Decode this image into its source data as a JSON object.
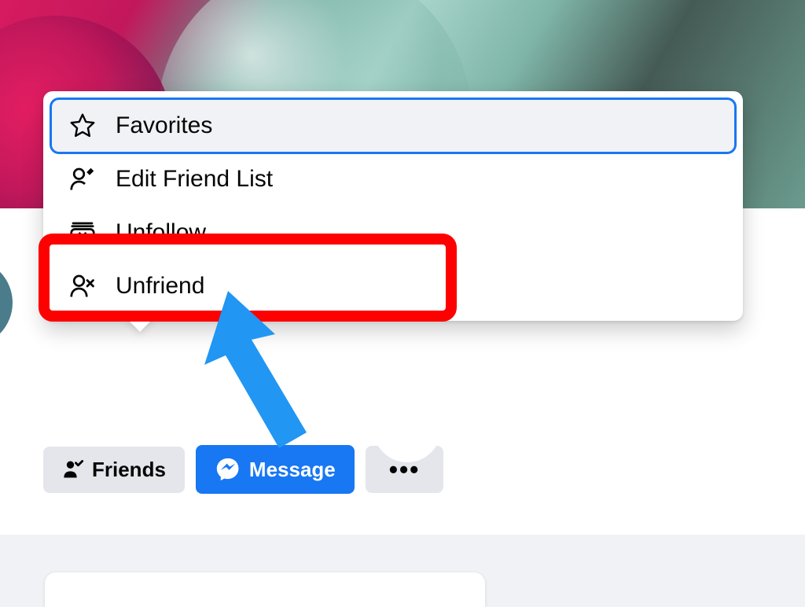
{
  "profile_actions": {
    "friends_label": "Friends",
    "message_label": "Message",
    "more_dots": "•••"
  },
  "friends_dropdown": {
    "items": [
      {
        "icon": "star-icon",
        "label": "Favorites",
        "hovered": true,
        "highlighted": false
      },
      {
        "icon": "person-edit-icon",
        "label": "Edit Friend List",
        "hovered": false,
        "highlighted": false
      },
      {
        "icon": "archive-x-icon",
        "label": "Unfollow",
        "hovered": false,
        "highlighted": true
      },
      {
        "icon": "person-remove-icon",
        "label": "Unfriend",
        "hovered": false,
        "highlighted": false
      }
    ]
  },
  "annotation": {
    "highlight_color": "#ff0000",
    "arrow_color": "#2196f3"
  }
}
